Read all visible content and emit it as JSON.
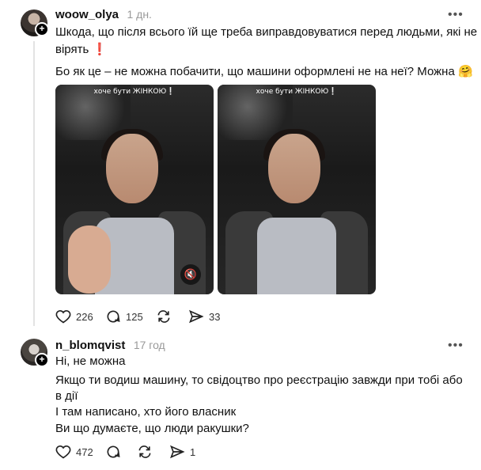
{
  "post": {
    "username": "woow_olya",
    "time": "1 дн.",
    "more": "•••",
    "text_line1": "Шкода, що після всього їй ще треба виправдовуватися перед людьми, які не",
    "text_line2": "вірять",
    "text_line2_emoji": "❗",
    "text_line3": "Бо як це – не можна побачити, що машини оформлені не на неї? Можна",
    "text_line3_emoji": "🤗",
    "media": [
      {
        "caption": "хоче бути ЖІНКОЮ❕"
      },
      {
        "caption": "хоче бути ЖІНКОЮ❕"
      }
    ],
    "actions": {
      "likes": "226",
      "comments": "125",
      "reposts": "",
      "shares": "33"
    }
  },
  "reply": {
    "username": "n_blomqvist",
    "time": "17 год",
    "more": "•••",
    "lines": [
      "Ні, не можна",
      "Якщо ти водиш машину, то свідоцтво про реєстрацію завжди при тобі або",
      "в дії",
      "І там написано, хто його власник",
      "Ви що думаєте, що люди ракушки?"
    ],
    "actions": {
      "likes": "472",
      "comments": "",
      "reposts": "",
      "shares": "1"
    }
  }
}
